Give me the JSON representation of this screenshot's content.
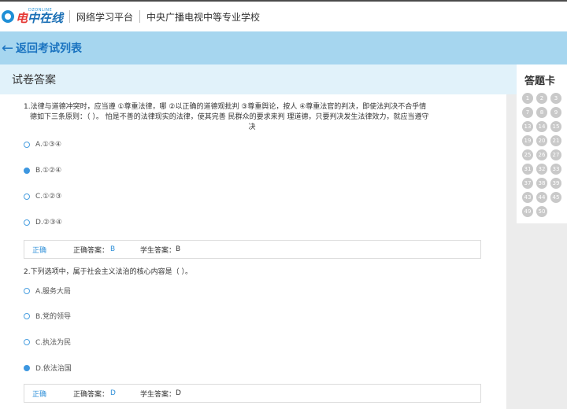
{
  "header": {
    "logo_small": "DZONLINE",
    "logo_text_a": "电",
    "logo_text_b": "中在线",
    "platform": "网络学习平台",
    "school": "中央广播电视中等专业学校"
  },
  "nav": {
    "back_icon": "arrow-left-icon",
    "back_label": "返回考试列表"
  },
  "paper": {
    "title": "试卷答案"
  },
  "questions": [
    {
      "stem_lines": [
        "1.法律与道德冲突时，应当遵 ①尊重法律，哪 ②以正确的道德观批判 ③尊重舆论，按人  ④尊重法官的判决，即使法判决不合乎情",
        "德如下三条原则：（  ）。 怕是不善的法律现实的法律，使其完善 民群众的要求来判  理道德，只要判决发生法律效力，就应当遵守",
        "决"
      ],
      "options": [
        {
          "label": "A.①③④",
          "selected": false
        },
        {
          "label": "B.①②④",
          "selected": true
        },
        {
          "label": "C.①②③",
          "selected": false
        },
        {
          "label": "D.②③④",
          "selected": false
        }
      ],
      "result": {
        "status": "正确",
        "correct_label": "正确答案：",
        "correct": "B",
        "student_label": "学生答案：",
        "student": "B"
      }
    },
    {
      "stem": "2.下列选项中，属于社会主义法治的核心内容是（  ）。",
      "options": [
        {
          "label": "A.服务大局",
          "selected": false
        },
        {
          "label": "B.党的领导",
          "selected": false
        },
        {
          "label": "C.执法为民",
          "selected": false
        },
        {
          "label": "D.依法治国",
          "selected": true
        }
      ],
      "result": {
        "status": "正确",
        "correct_label": "正确答案：",
        "correct": "D",
        "student_label": "学生答案：",
        "student": "D"
      }
    }
  ],
  "answer_card": {
    "title": "答题卡",
    "numbers": [
      "1",
      "2",
      "3",
      "7",
      "8",
      "9",
      "13",
      "14",
      "15",
      "19",
      "20",
      "21",
      "25",
      "26",
      "27",
      "31",
      "32",
      "33",
      "37",
      "38",
      "39",
      "43",
      "44",
      "45",
      "49",
      "50"
    ]
  },
  "colors": {
    "accent": "#2e8fd8",
    "nav_bg": "#a6d6ef",
    "sub_bg": "#e1f2fa",
    "card_circle": "#c9c9c9"
  }
}
